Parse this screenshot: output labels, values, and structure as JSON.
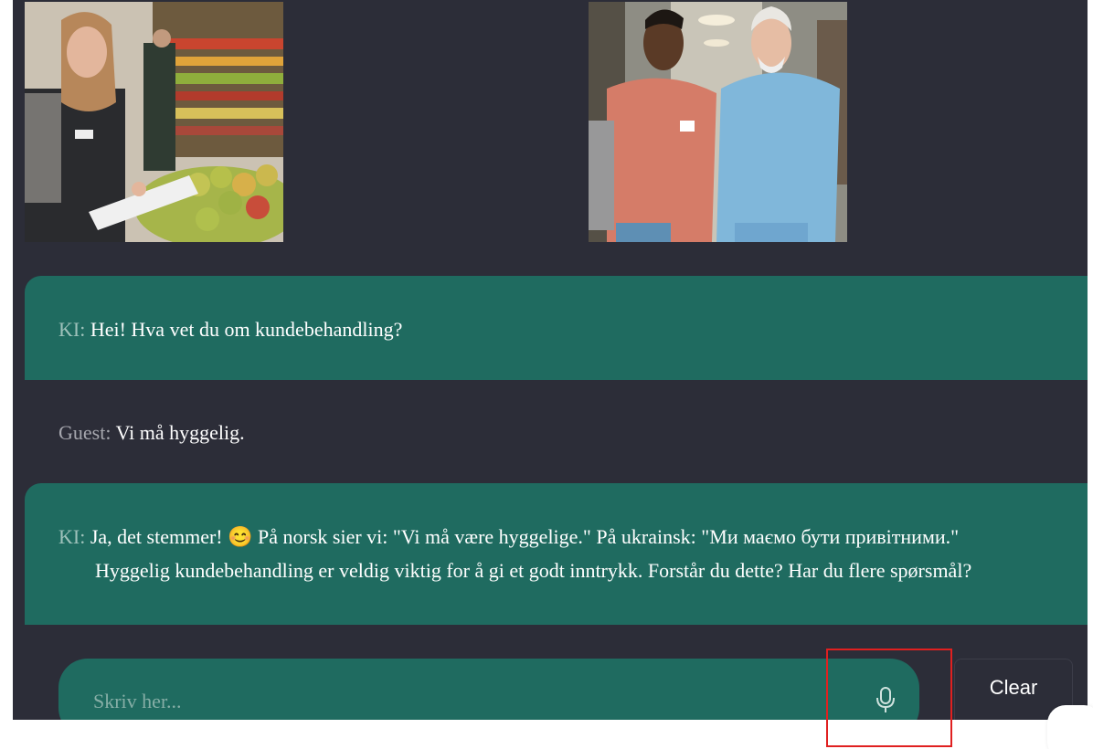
{
  "images": {
    "grocery": {
      "icon": "grocery-worker-image"
    },
    "hospital": {
      "icon": "nurses-hallway-image"
    }
  },
  "messages": [
    {
      "role": "ai",
      "speaker": "KI:",
      "text": "Hei! Hva vet du om kundebehandling?"
    },
    {
      "role": "guest",
      "speaker": "Guest:",
      "text": "Vi må hyggelig."
    },
    {
      "role": "ai",
      "speaker": "KI:",
      "line1": "Ja, det stemmer! 😊 På norsk sier vi: \"Vi må være hyggelige.\" På ukrainsk: \"Ми маємо бути привітними.\"",
      "line2": "Hyggelig kundebehandling er veldig viktig for å gi et godt inntrykk. Forstår du dette? Har du flere spørsmål?"
    }
  ],
  "input": {
    "placeholder": "Skriv her...",
    "value": ""
  },
  "buttons": {
    "clear_label": "Clear",
    "mic_icon": "microphone-icon"
  },
  "colors": {
    "panel_bg": "#2c2d38",
    "ai_bubble": "#1f6b60",
    "highlight": "#e02020"
  }
}
